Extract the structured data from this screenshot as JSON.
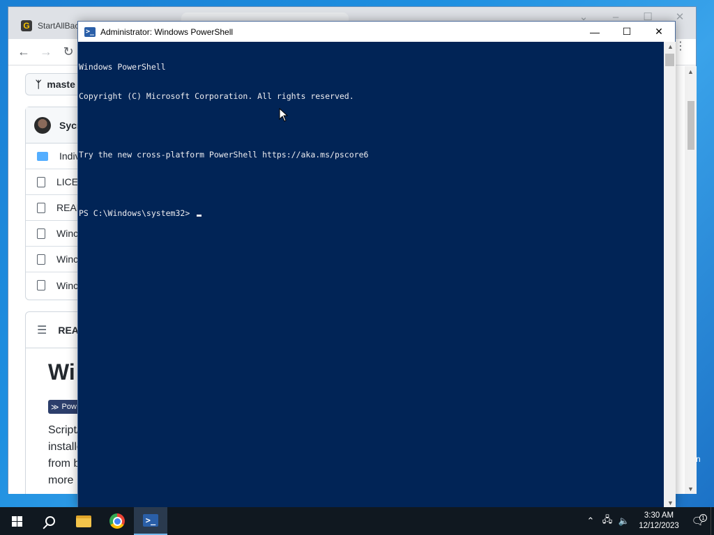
{
  "browser": {
    "tab_title": "StartAllBac",
    "tab_favicon": "G",
    "branch": "maste",
    "commit_author": "Sycn",
    "files": [
      {
        "name": "Indiv",
        "type": "folder"
      },
      {
        "name": "LICE",
        "type": "file"
      },
      {
        "name": "READ",
        "type": "file"
      },
      {
        "name": "Winc",
        "type": "file"
      },
      {
        "name": "Winc",
        "type": "file"
      },
      {
        "name": "Winc",
        "type": "file"
      }
    ],
    "readme_tab": "REA",
    "readme_title": "Wi",
    "badge_text": "Pow",
    "readme_lines": [
      "Script/",
      "installe",
      "from b",
      "more"
    ]
  },
  "powershell": {
    "title": "Administrator: Windows PowerShell",
    "lines": [
      "Windows PowerShell",
      "Copyright (C) Microsoft Corporation. All rights reserved.",
      "",
      "Try the new cross-platform PowerShell https://aka.ms/pscore6",
      "",
      "PS C:\\Windows\\system32> "
    ]
  },
  "taskbar": {
    "time": "3:30 AM",
    "date": "12/12/2023",
    "notification_count": "1",
    "edge_text": "n"
  },
  "colors": {
    "console_bg": "#012456",
    "console_fg": "#eeedf0",
    "taskbar_bg": "#101820"
  }
}
